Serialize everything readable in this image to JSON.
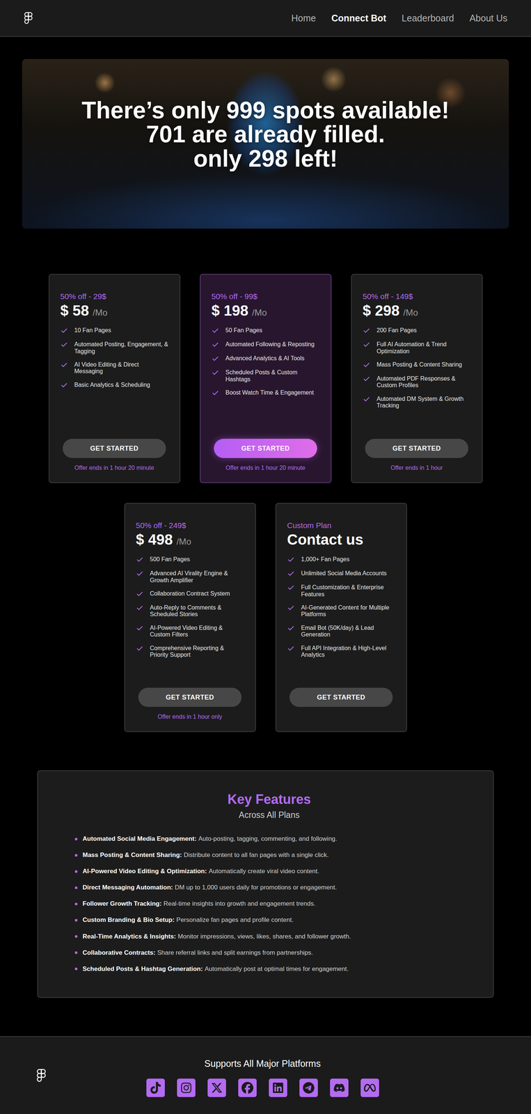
{
  "nav": {
    "items": [
      {
        "label": "Home",
        "selected": false
      },
      {
        "label": "Connect Bot",
        "selected": true
      },
      {
        "label": "Leaderboard",
        "selected": false
      },
      {
        "label": "About Us",
        "selected": false
      }
    ]
  },
  "hero": {
    "lines": [
      "There’s only 999 spots available!",
      "701 are already filled.",
      "only 298 left!"
    ]
  },
  "plans": [
    {
      "kind": "priced",
      "subtitle": "50% off - 29$",
      "price": "$ 58",
      "unit": "/Mo",
      "selected": false,
      "features": [
        "10 Fan Pages",
        "Automated Posting, Engagement, & Tagging",
        "AI Video Editing & Direct Messaging",
        "Basic Analytics & Scheduling"
      ],
      "button": "GET STARTED",
      "offer": "Offer ends in 1 hour 20 minute"
    },
    {
      "kind": "priced",
      "subtitle": "50% off - 99$",
      "price": "$ 198",
      "unit": "/Mo",
      "selected": true,
      "features": [
        "50 Fan Pages",
        "Automated Following & Reposting",
        "Advanced Analytics & AI Tools",
        "Scheduled Posts & Custom Hashtags",
        "Boost Watch Time & Engagement"
      ],
      "button": "GET STARTED",
      "offer": "Offer ends in 1 hour 20 minute"
    },
    {
      "kind": "priced",
      "subtitle": "50% off - 149$",
      "price": "$ 298",
      "unit": "/Mo",
      "selected": false,
      "features": [
        "200 Fan Pages",
        "Full AI Automation & Trend Optimization",
        "Mass Posting & Content Sharing",
        "Automated PDF Responses & Custom Profiles",
        "Automated DM System & Growth Tracking"
      ],
      "button": "GET STARTED",
      "offer": "Offer ends in 1 hour"
    },
    {
      "kind": "priced",
      "subtitle": "50% off - 249$",
      "price": "$ 498",
      "unit": "/Mo",
      "selected": false,
      "features": [
        "500 Fan Pages",
        "Advanced AI Virality Engine & Growth Amplifier",
        "Collaboration Contract System",
        "Auto-Reply to Comments & Scheduled Stories",
        "AI-Powered Video Editing & Custom Filters",
        "Comprehensive Reporting & Priority Support"
      ],
      "button": "GET STARTED",
      "offer": "Offer ends in 1 hour only"
    },
    {
      "kind": "custom",
      "subtitle": "Custom Plan",
      "price": "Contact us",
      "unit": "",
      "selected": false,
      "features": [
        "1,000+ Fan Pages",
        "Unlimited Social Media Accounts",
        "Full Customization & Enterprise Features",
        "AI-Generated Content for Multiple Platforms",
        "Email Bot (50K/day) & Lead Generation",
        "Full API Integration & High-Level Analytics"
      ],
      "button": "GET STARTED",
      "offer": ""
    }
  ],
  "key_features": {
    "title": "Key Features",
    "subtitle": "Across All Plans",
    "items": [
      {
        "label": "Automated Social Media Engagement:",
        "description": "Auto-posting, tagging, commenting, and following."
      },
      {
        "label": "Mass Posting & Content Sharing:",
        "description": "Distribute content to all fan pages with a single click."
      },
      {
        "label": "AI-Powered Video Editing & Optimization:",
        "description": "Automatically create viral video content."
      },
      {
        "label": "Direct Messaging Automation:",
        "description": "DM up to 1,000 users daily for promotions or engagement."
      },
      {
        "label": "Follower Growth Tracking:",
        "description": "Real-time insights into growth and engagement trends."
      },
      {
        "label": "Custom Branding & Bio Setup:",
        "description": "Personalize fan pages and profile content."
      },
      {
        "label": "Real-Time Analytics & Insights:",
        "description": "Monitor impressions, views, likes, shares, and follower growth."
      },
      {
        "label": "Collaborative Contracts:",
        "description": "Share referral links and split earnings from partnerships."
      },
      {
        "label": "Scheduled Posts & Hashtag Generation:",
        "description": "Automatically post at optimal times for engagement."
      }
    ]
  },
  "footer": {
    "title": "Supports All Major Platforms"
  }
}
